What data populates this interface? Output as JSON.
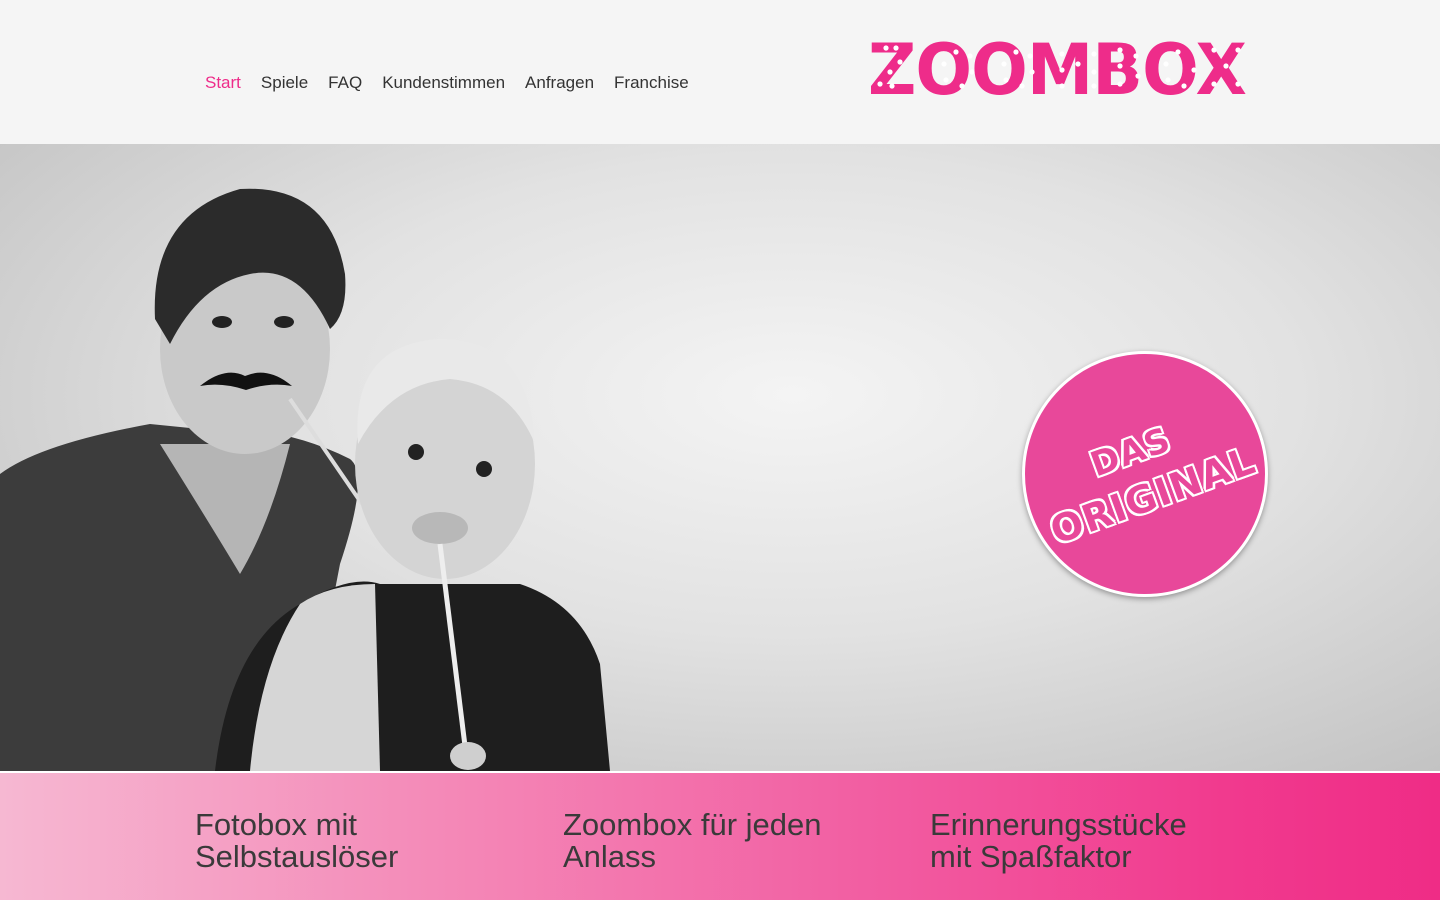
{
  "nav": {
    "items": [
      {
        "label": "Start",
        "active": true
      },
      {
        "label": "Spiele",
        "active": false
      },
      {
        "label": "FAQ",
        "active": false
      },
      {
        "label": "Kundenstimmen",
        "active": false
      },
      {
        "label": "Anfragen",
        "active": false
      },
      {
        "label": "Franchise",
        "active": false
      }
    ]
  },
  "logo": {
    "text": "ZOOMBOX"
  },
  "hero": {
    "badge": {
      "line1": "DAS",
      "line2": "ORIGINAL"
    }
  },
  "claims": [
    {
      "line1": "Fotobox mit",
      "line2": "Selbstauslöser"
    },
    {
      "line1": "Zoombox für jeden",
      "line2": "Anlass"
    },
    {
      "line1": "Erinnerungsstücke",
      "line2": "mit Spaßfaktor"
    }
  ],
  "colors": {
    "accent": "#ee2c8a",
    "badge": "#e8489a",
    "text": "#333333",
    "header_bg": "#f5f5f5"
  }
}
